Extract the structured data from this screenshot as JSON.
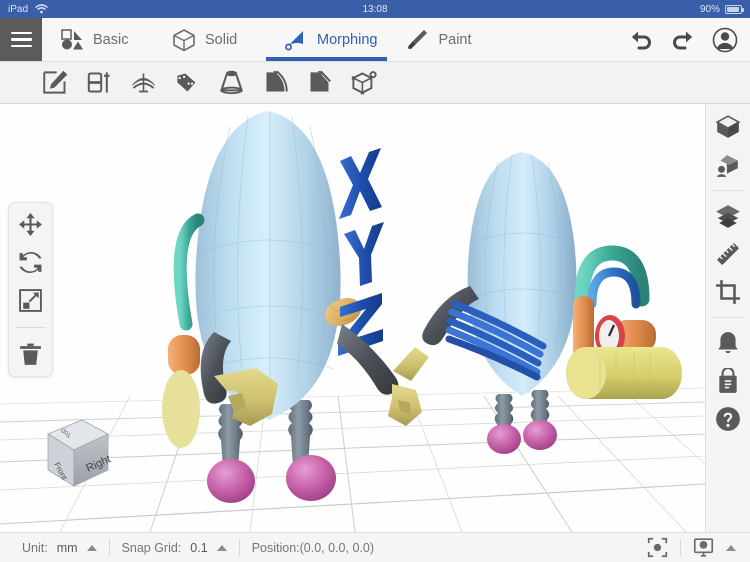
{
  "status_bar": {
    "device": "iPad",
    "wifi_icon": "wifi-icon",
    "time": "13:08",
    "battery_percent": "90%",
    "battery_icon": "battery-icon"
  },
  "tabbar": {
    "menu_icon": "hamburger-menu-icon",
    "tabs": [
      {
        "label": "Basic",
        "icon": "basic-shapes-icon",
        "active": false
      },
      {
        "label": "Solid",
        "icon": "solid-cube-icon",
        "active": false
      },
      {
        "label": "Morphing",
        "icon": "morphing-icon",
        "active": true
      },
      {
        "label": "Paint",
        "icon": "paint-brush-icon",
        "active": false
      }
    ],
    "undo_icon": "undo-icon",
    "redo_icon": "redo-icon",
    "account_icon": "account-icon",
    "active_color": "#2F62B2"
  },
  "toolbar": {
    "tools": [
      {
        "name": "edit-shape-tool",
        "title": "Edit"
      },
      {
        "name": "split-tool",
        "title": "Split"
      },
      {
        "name": "bend-dome-tool",
        "title": "Dome"
      },
      {
        "name": "twist-tool",
        "title": "Twist"
      },
      {
        "name": "taper-tool",
        "title": "Taper"
      },
      {
        "name": "curve-bend-tool",
        "title": "Bend"
      },
      {
        "name": "chamfer-tool",
        "title": "Chamfer"
      },
      {
        "name": "wireframe-node-tool",
        "title": "Vertex"
      }
    ]
  },
  "left_tools": {
    "items": [
      {
        "name": "move-tool",
        "icon": "move-arrows-icon"
      },
      {
        "name": "rotate-tool",
        "icon": "rotate-icon"
      },
      {
        "name": "scale-tool",
        "icon": "scale-icon"
      },
      {
        "name": "delete-tool",
        "icon": "trash-icon"
      }
    ]
  },
  "right_bar": {
    "items": [
      {
        "name": "objects-panel",
        "icon": "cube-icon"
      },
      {
        "name": "view-panel",
        "icon": "perspective-view-icon"
      },
      {
        "name": "layers-panel",
        "icon": "layers-icon"
      },
      {
        "name": "measure-panel",
        "icon": "ruler-icon"
      },
      {
        "name": "crop-panel",
        "icon": "crop-icon"
      },
      {
        "name": "notifications",
        "icon": "bell-icon"
      },
      {
        "name": "store-panel",
        "icon": "store-bag-icon"
      },
      {
        "name": "help-panel",
        "icon": "help-icon"
      }
    ]
  },
  "viewport": {
    "view_cube": {
      "front_face": "Right",
      "left_face": "Front",
      "top_face": "Top"
    },
    "grid_color": "#c9c9c9",
    "background": "#fefefe"
  },
  "bottom_bar": {
    "unit_label": "Unit:",
    "unit_value": "mm",
    "snap_label": "Snap Grid:",
    "snap_value": "0.1",
    "position_text": "Position:(0.0, 0.0, 0.0)",
    "focus_icon": "focus-target-icon",
    "display_icon": "display-monitor-icon",
    "display_caret": "caret-up-icon"
  }
}
